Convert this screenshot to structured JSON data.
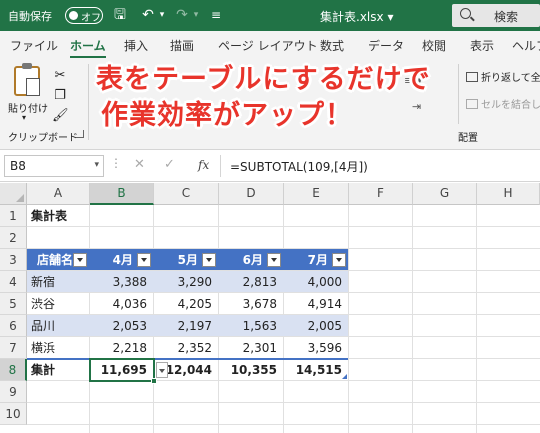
{
  "titlebar": {
    "autosave_label": "自動保存",
    "toggle_text": "オフ",
    "filename": "集計表.xlsx",
    "filename_arrow": "▾",
    "search_label": "検索"
  },
  "tabs": [
    "ファイル",
    "ホーム",
    "挿入",
    "描画",
    "ページ レイアウト",
    "数式",
    "データ",
    "校閲",
    "表示",
    "ヘルプ"
  ],
  "active_tab": "ホーム",
  "ribbon": {
    "paste_label": "貼り付け",
    "paste_arrow": "▾",
    "clipboard_group": "クリップボード",
    "wrap_text": "折り返して全体",
    "merge_center": "セルを結合して",
    "alignment_group": "配置"
  },
  "callout": {
    "line1": "表をテーブルにするだけで",
    "line2": "作業効率がアップ！",
    "color": "#e8342b"
  },
  "formula_bar": {
    "name_box": "B8",
    "cancel": "✕",
    "enter": "✓",
    "fx": "fx",
    "formula": "=SUBTOTAL(109,[4月])"
  },
  "grid": {
    "columns": [
      "A",
      "B",
      "C",
      "D",
      "E",
      "F",
      "G",
      "H"
    ],
    "rows": [
      "1",
      "2",
      "3",
      "4",
      "5",
      "6",
      "7",
      "8",
      "9",
      "10"
    ],
    "selected_column": "B",
    "selected_row": "8",
    "title_cell": "集計表",
    "table_headers": [
      "店舗名",
      "4月",
      "5月",
      "6月",
      "7月"
    ],
    "table_rows": [
      [
        "新宿",
        "3,388",
        "3,290",
        "2,813",
        "4,000"
      ],
      [
        "渋谷",
        "4,036",
        "4,205",
        "3,678",
        "4,914"
      ],
      [
        "品川",
        "2,053",
        "2,197",
        "1,563",
        "2,005"
      ],
      [
        "横浜",
        "2,218",
        "2,352",
        "2,301",
        "3,596"
      ]
    ],
    "total_row": [
      "集計",
      "11,695",
      "12,044",
      "10,355",
      "14,515"
    ],
    "header_color": "#4472c4",
    "band_color": "#d9e1f2"
  }
}
